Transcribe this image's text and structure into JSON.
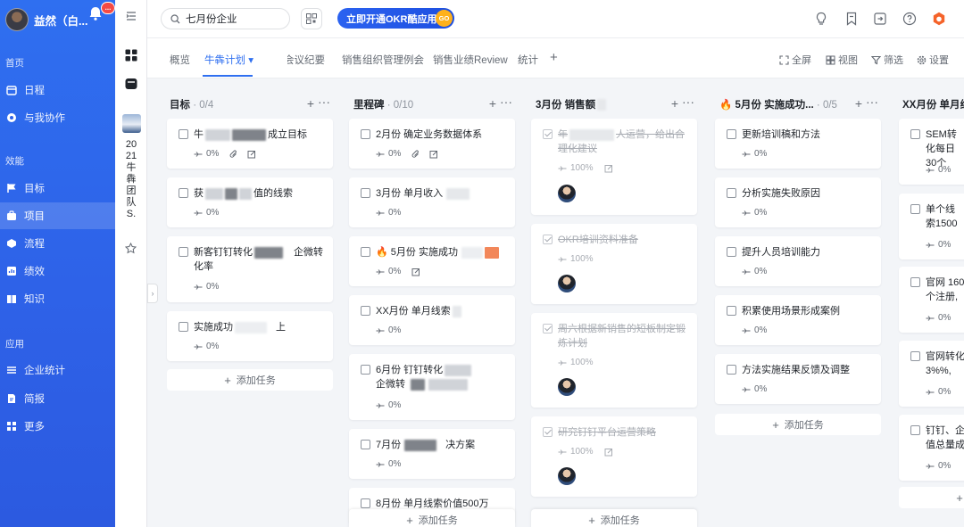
{
  "sidebar": {
    "user_name": "益然（白...",
    "badge": "...",
    "sections": [
      "首页",
      "效能",
      "应用"
    ],
    "items": [
      {
        "label": "日程",
        "icon": "calendar-icon"
      },
      {
        "label": "与我协作",
        "icon": "collab-icon"
      },
      {
        "label": "目标",
        "icon": "flag-icon"
      },
      {
        "label": "项目",
        "icon": "project-icon",
        "active": true
      },
      {
        "label": "流程",
        "icon": "flow-icon"
      },
      {
        "label": "绩效",
        "icon": "performance-icon"
      },
      {
        "label": "知识",
        "icon": "book-icon"
      },
      {
        "label": "企业统计",
        "icon": "stats-icon"
      },
      {
        "label": "简报",
        "icon": "report-icon"
      },
      {
        "label": "更多",
        "icon": "grid-icon"
      }
    ]
  },
  "secondary": {
    "team_name": "2021牛犇团队S."
  },
  "header": {
    "search_value": "七月份企业",
    "promo_label": "立即开通OKR酷应用",
    "promo_badge": "GO"
  },
  "tabs": {
    "items": [
      "概览",
      "牛犇计划",
      "会议纪要",
      "销售组织管理例会",
      "销售业绩Review",
      "统计"
    ],
    "active": "牛犇计划",
    "tools": [
      "全屏",
      "视图",
      "筛选",
      "设置"
    ]
  },
  "board": {
    "add_task_label": "添加任务",
    "columns": [
      {
        "title": "目标",
        "count": "· 0/4",
        "cards": [
          {
            "title": "牛",
            "title_tail": "成立目标",
            "progress": "0%",
            "icons": [
              "attachment",
              "edit"
            ]
          },
          {
            "title": "获",
            "title_tail": "值的线索",
            "progress": "0%"
          },
          {
            "title": "新客钉钉转化",
            "title_tail": "企微转化率",
            "progress": "0%"
          },
          {
            "title": "实施成功",
            "title_tail": "上",
            "progress": "0%"
          }
        ]
      },
      {
        "title": "里程碑",
        "count": "· 0/10",
        "cards": [
          {
            "title": "2月份 确定业务数据体系",
            "progress": "0%",
            "icons": [
              "attachment",
              "edit"
            ]
          },
          {
            "title": "3月份 单月收入",
            "progress": "0%"
          },
          {
            "title": "5月份 实施成功",
            "progress": "0%",
            "fire": true
          },
          {
            "title": "XX月份 单月线索",
            "progress": "0%"
          },
          {
            "title": "6月份 钉钉转化",
            "title_tail": "企微转",
            "progress": "0%"
          },
          {
            "title": "7月份",
            "title_tail": "决方案",
            "progress": "0%"
          },
          {
            "title": "8月份 单月线索价值500万"
          }
        ]
      },
      {
        "title": "3月份 销售额",
        "count": "",
        "cards": [
          {
            "title": "年",
            "title_tail": "人运营，给出合理化建议",
            "progress": "100%",
            "icons": [
              "edit"
            ],
            "done": true
          },
          {
            "title": "OKR培训资料准备",
            "progress": "100%",
            "done": true
          },
          {
            "title": "周六根据新销售的短板制定锻炼计划",
            "progress": "100%",
            "done": true
          },
          {
            "title": "研究钉钉平台运营策略",
            "progress": "100%",
            "icons": [
              "edit"
            ],
            "done": true
          }
        ]
      },
      {
        "title": "5月份 实施成功...",
        "count": "· 0/5",
        "fire": true,
        "cards": [
          {
            "title": "更新培训稿和方法",
            "progress": "0%"
          },
          {
            "title": "分析实施失败原因",
            "progress": "0%"
          },
          {
            "title": "提升人员培训能力",
            "progress": "0%"
          },
          {
            "title": "积累使用场景形成案例",
            "progress": "0%"
          },
          {
            "title": "方法实施结果反馈及调整",
            "progress": "0%"
          }
        ]
      },
      {
        "title": "XX月份 单月线索",
        "count": "",
        "cards": [
          {
            "title": "SEM转化每日30个",
            "progress": "0%"
          },
          {
            "title": "单个线索1500",
            "progress": "0%"
          },
          {
            "title": "官网 160个注册,",
            "progress": "0%"
          },
          {
            "title": "官网转化3%%,",
            "progress": "0%"
          },
          {
            "title": "钉钉、企值总量成",
            "progress": "0%"
          }
        ]
      }
    ]
  }
}
